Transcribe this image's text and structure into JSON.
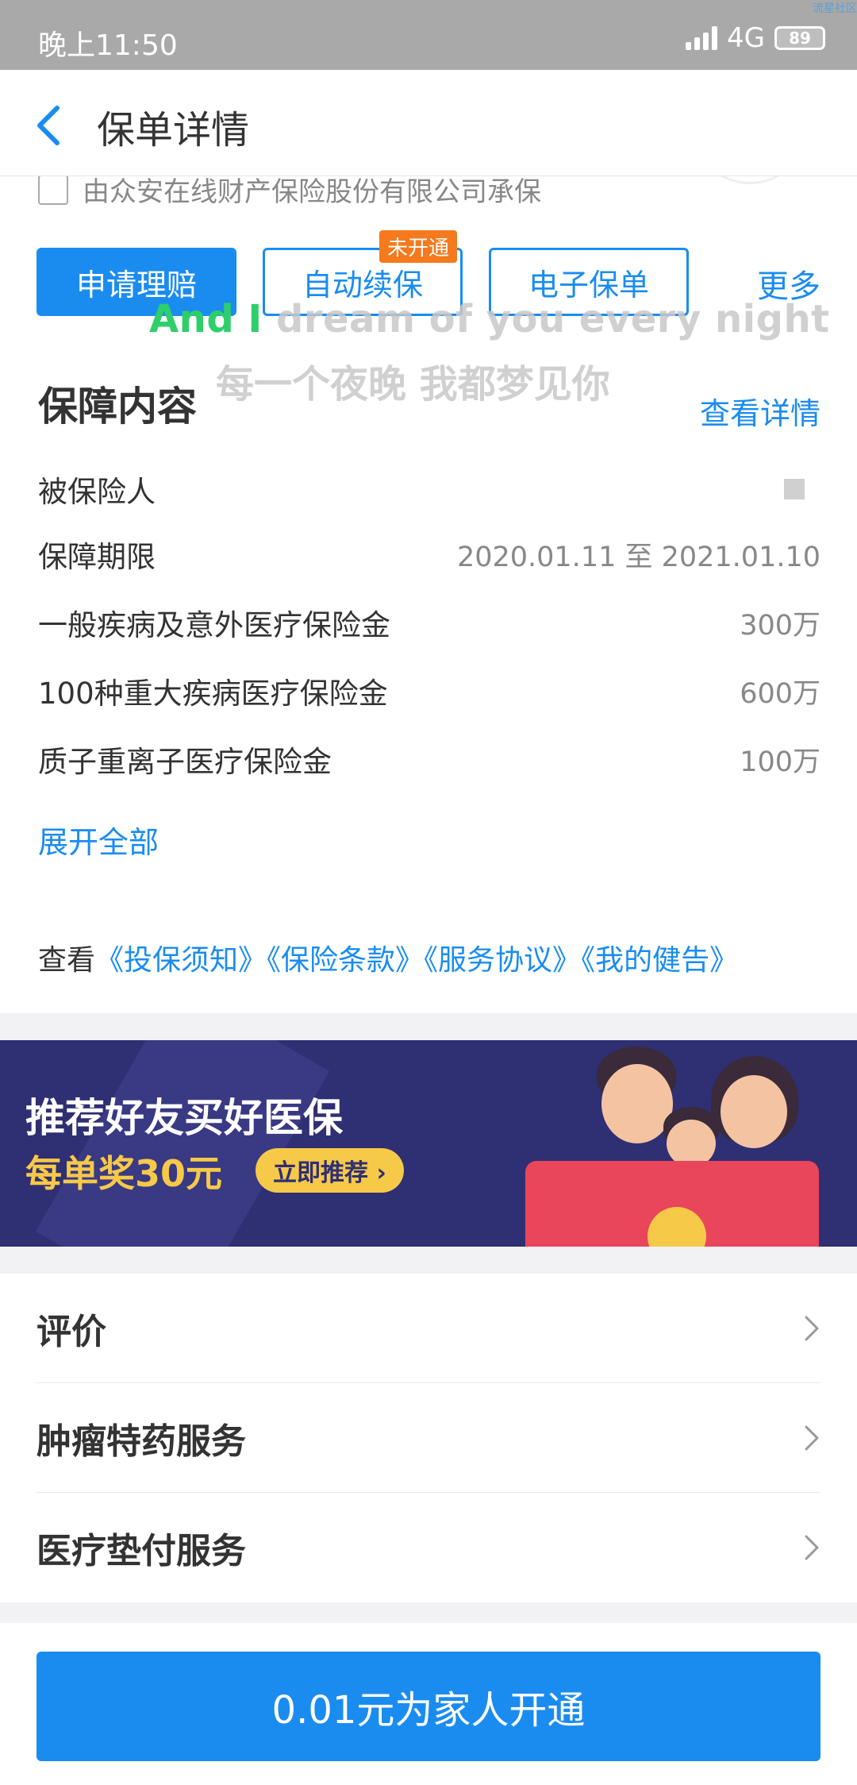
{
  "status_bar": {
    "time": "晚上11:50",
    "network": "4G",
    "battery": "89",
    "corner_text": "流星社区"
  },
  "header": {
    "title": "保单详情"
  },
  "company": {
    "text": "由众安在线财产保险股份有限公司承保"
  },
  "actions": {
    "claim": "申请理赔",
    "renew": "自动续保",
    "renew_tag": "未开通",
    "epolicy": "电子保单",
    "more": "更多"
  },
  "overlay": {
    "en_highlight": "And I",
    "en_rest": " dream of you every night",
    "zh": "每一个夜晚 我都梦见你"
  },
  "coverage": {
    "title": "保障内容",
    "view_detail": "查看详情",
    "rows": [
      {
        "label": "被保险人",
        "value": ""
      },
      {
        "label": "保障期限",
        "value": "2020.01.11 至 2021.01.10"
      },
      {
        "label": "一般疾病及意外医疗保险金",
        "value": "300万"
      },
      {
        "label": "100种重大疾病医疗保险金",
        "value": "600万"
      },
      {
        "label": "质子重离子医疗保险金",
        "value": "100万"
      }
    ],
    "expand": "展开全部"
  },
  "docs": {
    "prefix": "查看",
    "links": [
      "《投保须知》",
      "《保险条款》",
      "《服务协议》",
      "《我的健告》"
    ]
  },
  "banner": {
    "line1": "推荐好友买好医保",
    "line2": "每单奖30元",
    "cta": "立即推荐 ›"
  },
  "list": [
    {
      "label": "评价"
    },
    {
      "label": "肿瘤特药服务"
    },
    {
      "label": "医疗垫付服务"
    }
  ],
  "bottom": {
    "cta": "0.01元为家人开通"
  },
  "colors": {
    "accent": "#1a8cf0",
    "tag": "#f47a1d",
    "banner_bg": "#2f2f73",
    "banner_gold": "#f7c948"
  }
}
